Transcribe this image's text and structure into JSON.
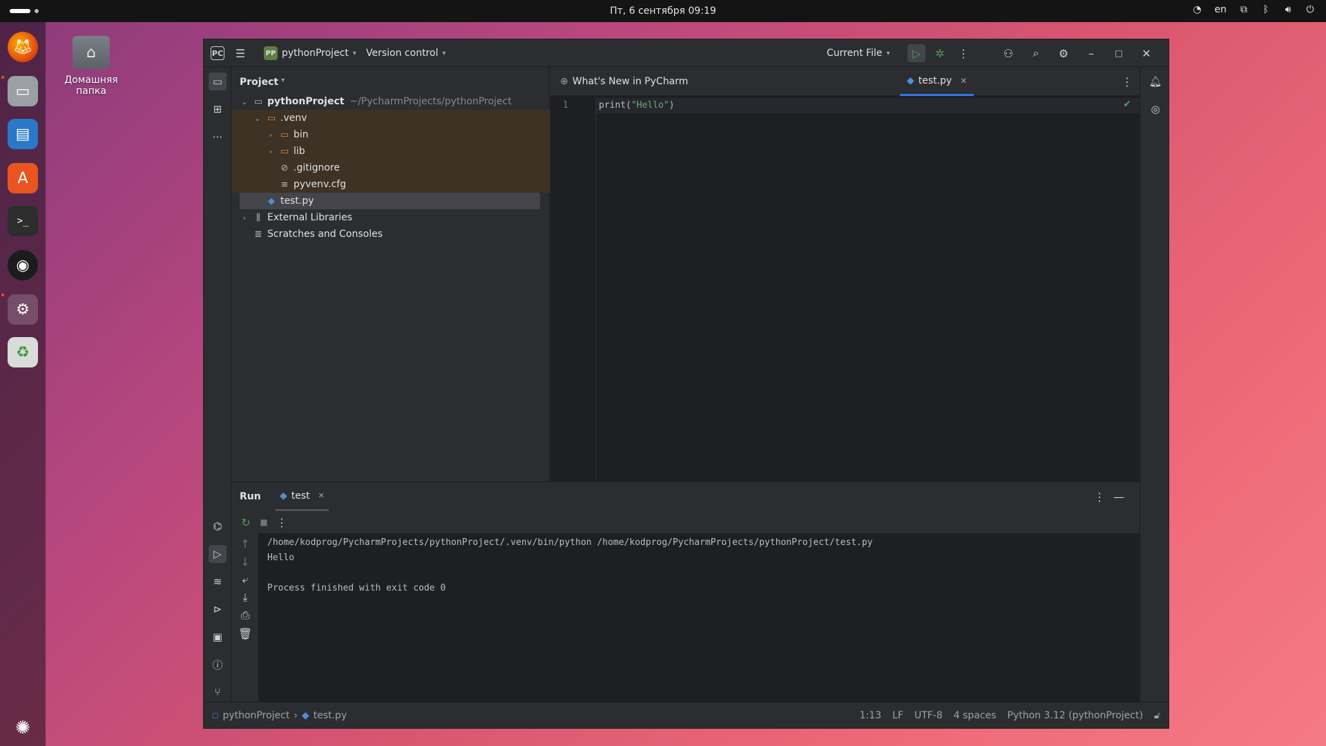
{
  "topbar": {
    "clock": "Пт, 6 сентября  09:19",
    "lang": "en"
  },
  "desktop": {
    "home_folder_label": "Домашняя папка"
  },
  "ide": {
    "project_selector": "pythonProject",
    "project_badge": "PP",
    "vcs": "Version control",
    "run_config": "Current File",
    "project_pane_title": "Project",
    "tree": {
      "root": "pythonProject",
      "root_path": "~/PycharmProjects/pythonProject",
      "venv": ".venv",
      "bin": "bin",
      "lib": "lib",
      "gitignore": ".gitignore",
      "pyvenv": "pyvenv.cfg",
      "testpy": "test.py",
      "external": "External Libraries",
      "scratches": "Scratches and Consoles"
    },
    "tabs": {
      "whats_new": "What's New in PyCharm",
      "test": "test.py"
    },
    "editor": {
      "line_number": "1",
      "code_fn": "print(",
      "code_str": "\"Hello\"",
      "code_end": ")"
    },
    "run": {
      "title": "Run",
      "tab": "test",
      "console": {
        "cmd": "/home/kodprog/PycharmProjects/pythonProject/.venv/bin/python /home/kodprog/PycharmProjects/pythonProject/test.py",
        "output": "Hello",
        "exit": "Process finished with exit code 0"
      }
    },
    "status": {
      "breadcrumb_project": "pythonProject",
      "breadcrumb_file": "test.py",
      "position": "1:13",
      "line_sep": "LF",
      "encoding": "UTF-8",
      "indent": "4 spaces",
      "interpreter": "Python 3.12 (pythonProject)"
    }
  },
  "colors": {
    "accent": "#3574f0",
    "run_green": "#57965c",
    "venv_highlight": "#3d3223",
    "string_green": "#6aab73"
  }
}
